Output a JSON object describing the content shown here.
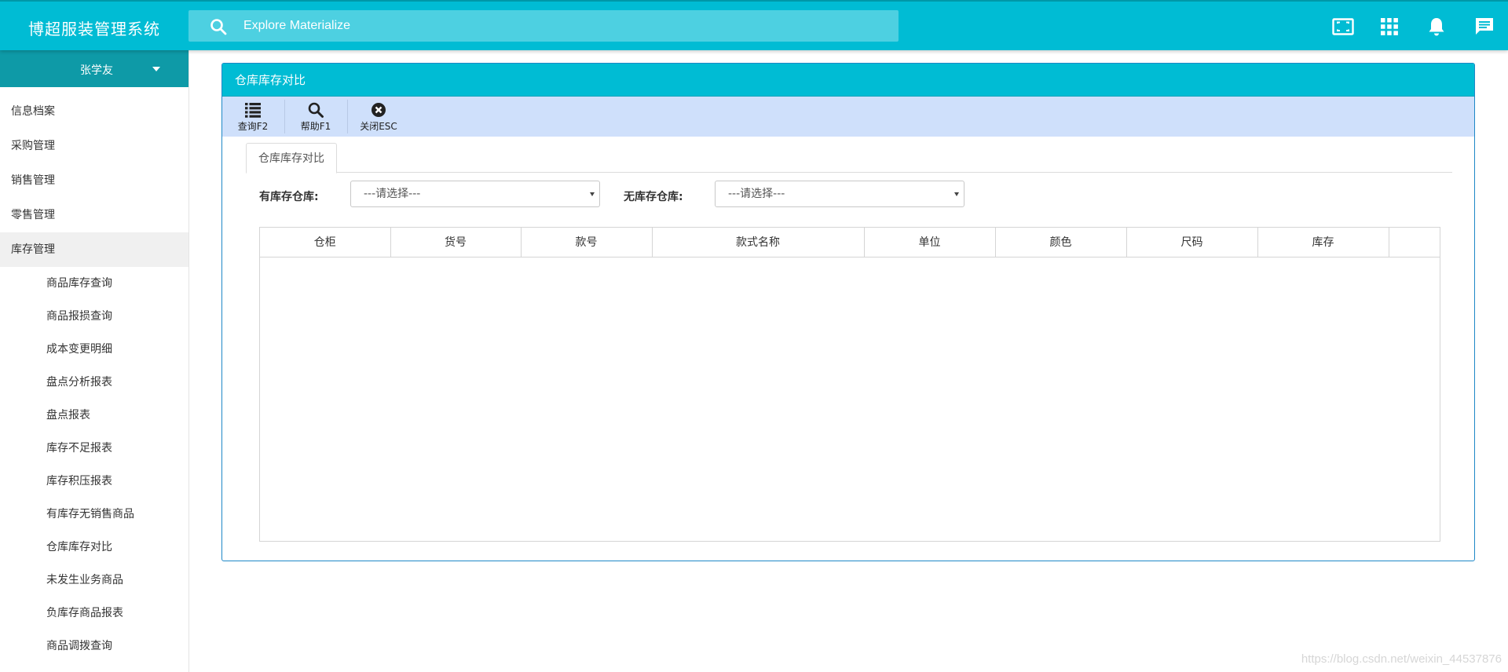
{
  "app": {
    "title": "博超服装管理系统"
  },
  "search": {
    "placeholder": "Explore Materialize"
  },
  "topbar_icons": [
    "fullscreen-icon",
    "apps-grid-icon",
    "notification-bell-icon",
    "chat-message-icon"
  ],
  "user": {
    "name": "张学友"
  },
  "sidebar": {
    "items": [
      {
        "label": "信息档案"
      },
      {
        "label": "采购管理"
      },
      {
        "label": "销售管理"
      },
      {
        "label": "零售管理"
      },
      {
        "label": "库存管理",
        "active": true
      }
    ],
    "subitems": [
      {
        "label": "商品库存查询"
      },
      {
        "label": "商品报损查询"
      },
      {
        "label": "成本变更明细"
      },
      {
        "label": "盘点分析报表"
      },
      {
        "label": "盘点报表"
      },
      {
        "label": "库存不足报表"
      },
      {
        "label": "库存积压报表"
      },
      {
        "label": "有库存无销售商品"
      },
      {
        "label": "仓库库存对比"
      },
      {
        "label": "未发生业务商品"
      },
      {
        "label": "负库存商品报表"
      },
      {
        "label": "商品调拨查询"
      }
    ]
  },
  "panel": {
    "title": "仓库库存对比",
    "toolbar": {
      "query": "查询F2",
      "help": "帮助F1",
      "close": "关闭ESC"
    },
    "tab": "仓库库存对比",
    "filters": {
      "with_stock_label": "有库存仓库:",
      "with_stock_value": "---请选择---",
      "without_stock_label": "无库存仓库:",
      "without_stock_value": "---请选择---"
    },
    "table": {
      "columns": [
        "仓柜",
        "货号",
        "款号",
        "款式名称",
        "单位",
        "颜色",
        "尺码",
        "库存",
        ""
      ],
      "rows": []
    }
  },
  "watermark": "https://blog.csdn.net/weixin_44537876",
  "colors": {
    "primary": "#00bcd4",
    "user_bar": "#0e9aa7",
    "toolbar": "#cfe0fb",
    "panel_border": "#1e88c7"
  }
}
